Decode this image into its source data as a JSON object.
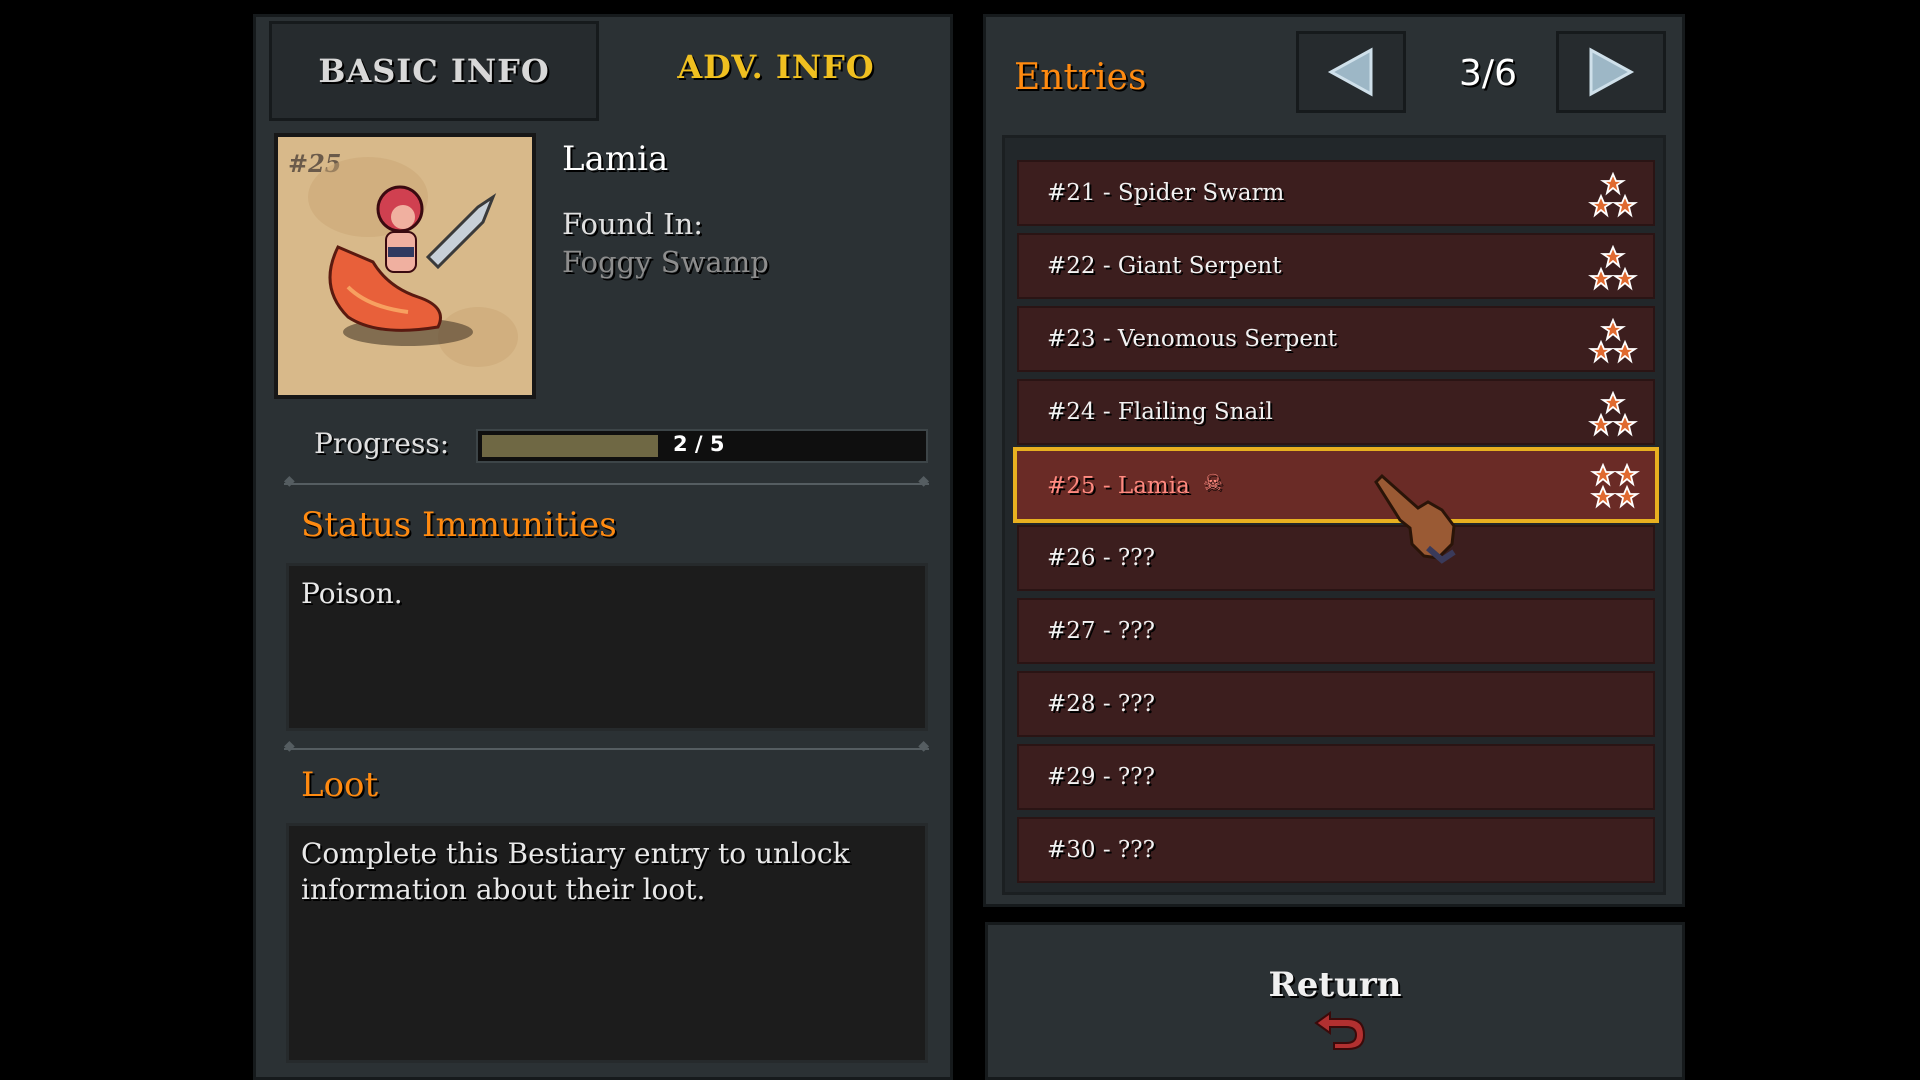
{
  "tabs": {
    "basic": "BASIC INFO",
    "adv": "ADV. INFO"
  },
  "monster": {
    "number": "#25",
    "name": "Lamia",
    "found_label": "Found In:",
    "found_value": "Foggy Swamp",
    "progress_label": "Progress:",
    "progress_text": "2 / 5",
    "progress_fraction": 0.4
  },
  "immunities": {
    "title": "Status Immunities",
    "text": "Poison."
  },
  "loot": {
    "title": "Loot",
    "text": "Complete this Bestiary entry to unlock information about their loot."
  },
  "entries": {
    "title": "Entries",
    "page": "3/6",
    "items": [
      {
        "label": "#21 - Spider Swarm",
        "stars": "three-stars-icon"
      },
      {
        "label": "#22 - Giant Serpent",
        "stars": "three-stars-icon"
      },
      {
        "label": "#23 - Venomous Serpent",
        "stars": "three-stars-icon"
      },
      {
        "label": "#24 - Flailing Snail",
        "stars": "three-stars-icon"
      },
      {
        "label": "#25 - Lamia",
        "stars": "four-stars-icon",
        "selected": true
      },
      {
        "label": "#26 - ???"
      },
      {
        "label": "#27 - ???"
      },
      {
        "label": "#28 - ???"
      },
      {
        "label": "#29 - ???"
      },
      {
        "label": "#30 - ???"
      }
    ]
  },
  "return": {
    "label": "Return"
  },
  "colors": {
    "accent_orange": "#ff8a10",
    "selected_border": "#e8b020",
    "active_tab": "#f0c020"
  }
}
